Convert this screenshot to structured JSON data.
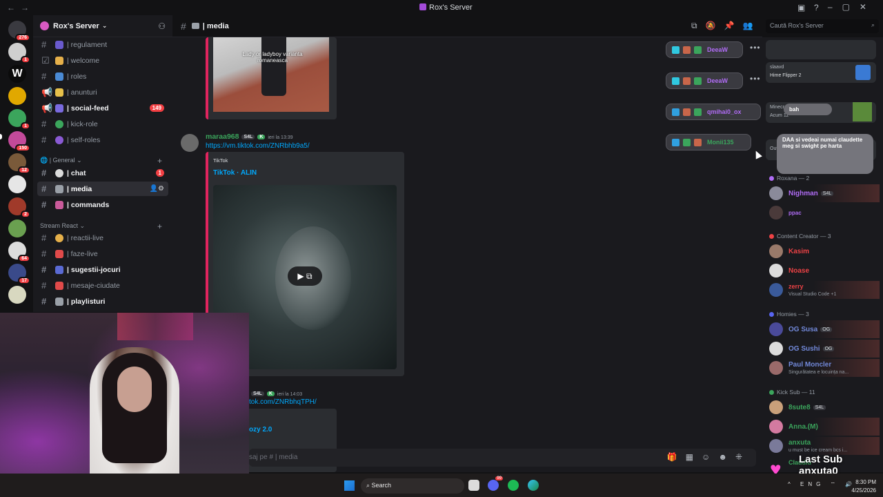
{
  "window": {
    "title": "Rox's Server"
  },
  "colors": {
    "accent": "#5865f2",
    "mention_red": "#f23f43",
    "link": "#00a8fc",
    "green_user": "#3ba55c",
    "purple_user": "#b06cf5",
    "red_user": "#ed4245",
    "cyan_user": "#30c8e0"
  },
  "server_rail": {
    "icons": [
      {
        "name": "direct-messages",
        "badge": "276"
      },
      {
        "name": "server-2",
        "badge": "1"
      },
      {
        "name": "server-w",
        "badge": ""
      },
      {
        "name": "server-4",
        "badge": ""
      },
      {
        "name": "server-5",
        "badge": "1"
      },
      {
        "name": "server-6",
        "badge": "150"
      },
      {
        "name": "server-7",
        "badge": "12"
      },
      {
        "name": "server-8",
        "badge": ""
      },
      {
        "name": "server-9",
        "badge": "2"
      },
      {
        "name": "server-10",
        "badge": ""
      },
      {
        "name": "server-11",
        "badge": "64"
      },
      {
        "name": "server-12",
        "badge": "17"
      },
      {
        "name": "server-13",
        "badge": ""
      }
    ]
  },
  "sidebar": {
    "server_name": "Rox's Server",
    "channels_top": [
      {
        "label": "| regulament",
        "bold": false,
        "badge": ""
      },
      {
        "label": "| welcome",
        "bold": false,
        "badge": ""
      },
      {
        "label": "| roles",
        "bold": false,
        "badge": ""
      },
      {
        "label": "| anunturi",
        "bold": false,
        "badge": ""
      },
      {
        "label": "| social-feed",
        "bold": true,
        "badge": "149"
      },
      {
        "label": "| kick-role",
        "bold": false,
        "badge": ""
      },
      {
        "label": "| self-roles",
        "bold": false,
        "badge": ""
      }
    ],
    "category_general": "| General",
    "channels_general": [
      {
        "label": "| chat",
        "bold": true,
        "badge": "1"
      },
      {
        "label": "| media",
        "bold": true,
        "badge": ""
      },
      {
        "label": "| commands",
        "bold": true,
        "badge": ""
      }
    ],
    "category_stream": "Stream React",
    "channels_stream": [
      {
        "label": "| reactii-live",
        "bold": false
      },
      {
        "label": "| faze-live",
        "bold": false
      },
      {
        "label": "| sugestii-jocuri",
        "bold": true
      },
      {
        "label": "| mesaje-ciudate",
        "bold": false
      },
      {
        "label": "| playlisturi",
        "bold": true
      }
    ]
  },
  "chat_header": {
    "channel": "| media",
    "search_placeholder": "Caută Rox's Server"
  },
  "messages": [
    {
      "image_caption": "Lady or ladyboy varianta romaneasca"
    },
    {
      "author": "maraa968",
      "tag": "S4L",
      "time": "ieri la 13:39",
      "link": "https://vm.tiktok.com/ZNRbhb9a5/",
      "embed_provider": "TikTok",
      "embed_title": "TikTok · ALIN"
    },
    {
      "tag": "S4L",
      "time": "ieri la 14:03",
      "link": "tok.com/ZNRbhqTPH/",
      "embed_title": "ozy 2.0"
    }
  ],
  "reaction_chips": [
    {
      "user": "DeeaW",
      "color": "#b06cf5"
    },
    {
      "user": "DeeaW",
      "color": "#b06cf5"
    },
    {
      "user": "qmihai0_ox",
      "color": "#b06cf5"
    },
    {
      "user": "Monii135",
      "color": "#3ba55c"
    }
  ],
  "composer": {
    "placeholder": "saj pe #",
    "channel": "| media"
  },
  "members": {
    "activities": [
      {
        "text": "slaavd"
      },
      {
        "text": "Hime Flipper 2"
      },
      {
        "text": "Minecra"
      },
      {
        "text": "Acum 1z"
      },
      {
        "text": "Outh"
      }
    ],
    "bubbles": {
      "bah": "bah",
      "daa": "DAA si vedeai numai claudette meg si swight pe harta"
    },
    "groups": [
      {
        "title": "Roxana — 2",
        "color": "#b06cf5",
        "items": [
          {
            "name": "Nighman",
            "tag": "S4L",
            "color": "#b06cf5",
            "sub": ""
          },
          {
            "name": "ppac",
            "tag": "",
            "color": "#b06cf5",
            "sub": ""
          }
        ]
      },
      {
        "title": "Content Creator — 3",
        "color": "#ed4245",
        "items": [
          {
            "name": "Kasim",
            "tag": "",
            "color": "#ed4245",
            "sub": ""
          },
          {
            "name": "Noase",
            "tag": "",
            "color": "#ed4245",
            "sub": ""
          },
          {
            "name": "zerry",
            "tag": "",
            "color": "#ed4245",
            "sub": "Visual Studio Code +1"
          }
        ]
      },
      {
        "title": "Homies — 3",
        "color": "#5865f2",
        "items": [
          {
            "name": "OG Susa",
            "tag": "OG",
            "color": "#5865f2",
            "sub": ""
          },
          {
            "name": "OG Sushi",
            "tag": "OG",
            "color": "#5865f2",
            "sub": ""
          },
          {
            "name": "Paul Moncler",
            "tag": "",
            "color": "#5865f2",
            "sub": "Singurătatea e locuința na..."
          }
        ]
      },
      {
        "title": "Kick Sub — 11",
        "color": "#3ba55c",
        "items": [
          {
            "name": "8sute8",
            "tag": "S4L",
            "color": "#3ba55c",
            "sub": ""
          },
          {
            "name": "Anna.(M)",
            "tag": "",
            "color": "#3ba55c",
            "sub": ""
          },
          {
            "name": "anxuta",
            "tag": "",
            "color": "#3ba55c",
            "sub": "u must be ice cream bcs i..."
          },
          {
            "name": "Claudiu",
            "tag": "",
            "color": "#3ba55c",
            "sub": ""
          }
        ]
      }
    ]
  },
  "overlay": {
    "last_sub_label": "Last Sub",
    "last_sub_name": "anxuta0"
  },
  "taskbar": {
    "search_label": "Search",
    "lang": "ENG",
    "time": "8:30 PM",
    "date": "4/25/2026",
    "discord_badge": "99"
  }
}
